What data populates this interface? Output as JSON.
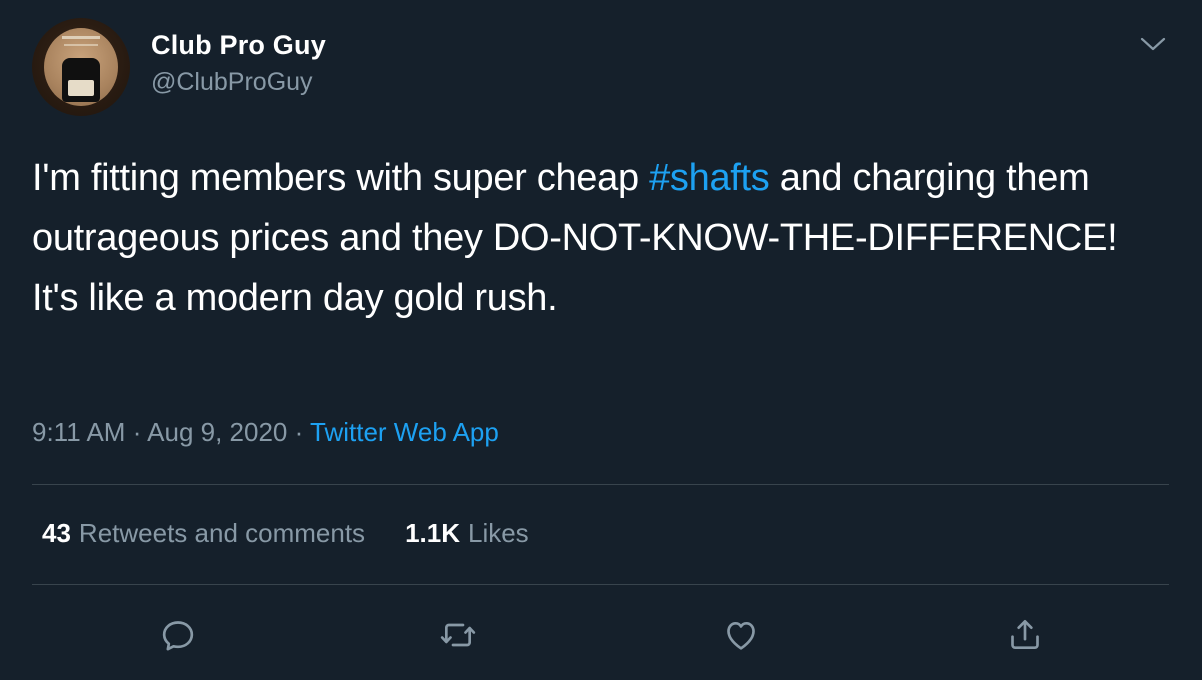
{
  "author": {
    "display_name": "Club Pro Guy",
    "handle": "@ClubProGuy"
  },
  "tweet": {
    "text_before": "I'm fitting members with super cheap ",
    "hashtag": "#shafts",
    "text_after": " and charging them outrageous prices and they DO-NOT-KNOW-THE-DIFFERENCE! It's like a modern day gold rush."
  },
  "meta": {
    "time": "9:11 AM",
    "separator": " · ",
    "date": "Aug 9, 2020",
    "source": "Twitter Web App"
  },
  "stats": {
    "retweets_count": "43",
    "retweets_label": "Retweets and comments",
    "likes_count": "1.1K",
    "likes_label": "Likes"
  },
  "actions": {
    "icons": [
      "reply-icon",
      "retweet-icon",
      "like-icon",
      "share-icon"
    ]
  },
  "colors": {
    "background": "#15202b",
    "text": "#ffffff",
    "secondary_text": "#8899a6",
    "accent": "#1da1f2",
    "divider": "#38444d"
  }
}
